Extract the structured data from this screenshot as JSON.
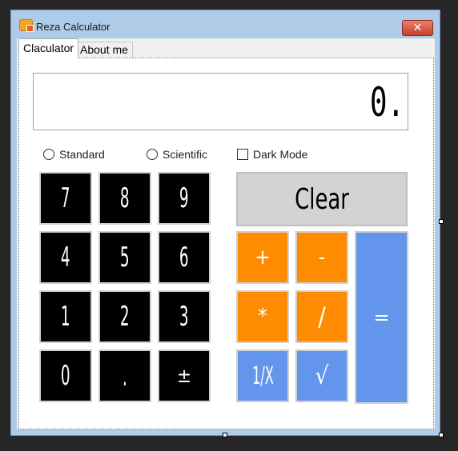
{
  "window": {
    "title": "Reza Calculator",
    "close_glyph": "✕"
  },
  "tabs": [
    {
      "label": "Claculator",
      "active": true
    },
    {
      "label": "About me",
      "active": false
    }
  ],
  "display": {
    "value": "0."
  },
  "options": {
    "standard": {
      "label": "Standard",
      "selected": false
    },
    "scientific": {
      "label": "Scientific",
      "selected": false
    },
    "dark_mode": {
      "label": "Dark Mode",
      "checked": false
    }
  },
  "keypad": {
    "digits": [
      "7",
      "8",
      "9",
      "4",
      "5",
      "6",
      "1",
      "2",
      "3",
      "0",
      ".",
      "±"
    ],
    "clear": "Clear",
    "plus": "+",
    "minus": "-",
    "multiply": "*",
    "divide": "/",
    "reciprocal": "1/X",
    "sqrt": "√",
    "equals": "="
  },
  "colors": {
    "digit_bg": "#000000",
    "operator_bg": "#ff8c00",
    "function_bg": "#6495ed",
    "clear_bg": "#d3d3d3"
  }
}
